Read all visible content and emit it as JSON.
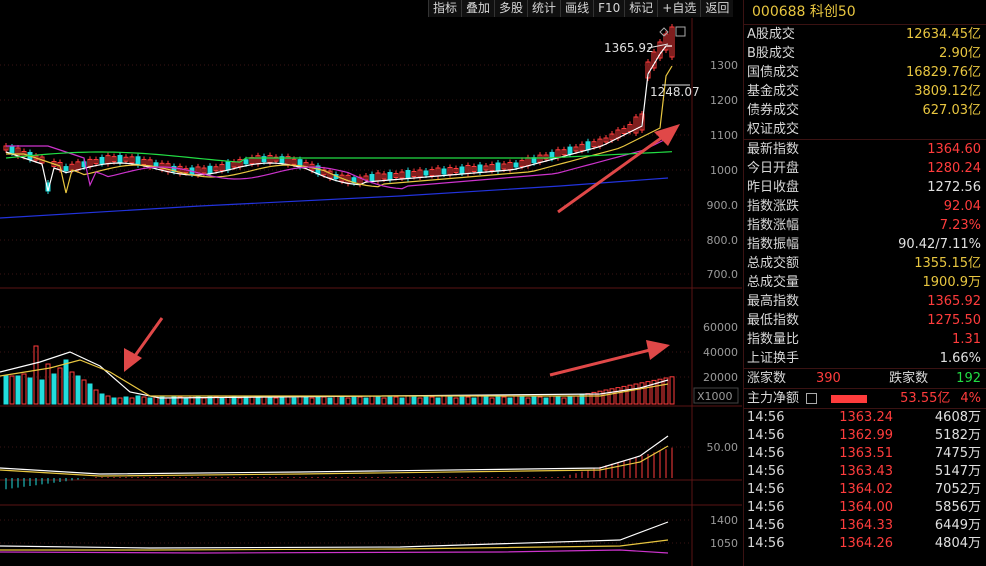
{
  "toolbar": {
    "items": [
      "指标",
      "叠加",
      "多股",
      "统计",
      "画线",
      "F10",
      "标记",
      "+自选",
      "返回"
    ]
  },
  "chart": {
    "price_axis": [
      "1300",
      "1200",
      "1100",
      "1000",
      "900.0",
      "800.0",
      "700.0"
    ],
    "high_label": "1365.92",
    "low_label": "1248.07",
    "volume_axis": [
      "60000",
      "40000",
      "20000"
    ],
    "volume_unit": "X1000",
    "indicator1_axis": [
      "50.00"
    ],
    "indicator2_axis": [
      "1400",
      "1050"
    ],
    "colors": {
      "up": "#ff3c3c",
      "down": "#22dddd",
      "ma5": "#ffffff",
      "ma10": "#e8c640",
      "ma20": "#cc33cc",
      "ma60": "#22dd44",
      "ma250": "#2233dd",
      "annotation": "#e04848"
    }
  },
  "panel": {
    "title": "000688 科创50",
    "market_stats": [
      {
        "label": "A股成交",
        "value": "12634.45亿"
      },
      {
        "label": "B股成交",
        "value": "2.90亿"
      },
      {
        "label": "国债成交",
        "value": "16829.76亿"
      },
      {
        "label": "基金成交",
        "value": "3809.12亿"
      },
      {
        "label": "债券成交",
        "value": "627.03亿"
      },
      {
        "label": "权证成交",
        "value": ""
      }
    ],
    "index_stats": [
      {
        "label": "最新指数",
        "value": "1364.60",
        "color": "red"
      },
      {
        "label": "今日开盘",
        "value": "1280.24",
        "color": "red"
      },
      {
        "label": "昨日收盘",
        "value": "1272.56",
        "color": "white"
      },
      {
        "label": "指数涨跌",
        "value": "92.04",
        "color": "red"
      },
      {
        "label": "指数涨幅",
        "value": "7.23%",
        "color": "red"
      },
      {
        "label": "指数振幅",
        "value": "90.42/7.11%",
        "color": "white"
      },
      {
        "label": "总成交额",
        "value": "1355.15亿",
        "color": "yellow"
      },
      {
        "label": "总成交量",
        "value": "1900.9万",
        "color": "yellow"
      },
      {
        "label": "最高指数",
        "value": "1365.92",
        "color": "red"
      },
      {
        "label": "最低指数",
        "value": "1275.50",
        "color": "red"
      },
      {
        "label": "指数量比",
        "value": "1.31",
        "color": "red"
      },
      {
        "label": "上证换手",
        "value": "1.66%",
        "color": "white"
      }
    ],
    "breadth": {
      "up_label": "涨家数",
      "up_value": "390",
      "down_label": "跌家数",
      "down_value": "192"
    },
    "main_flow": {
      "label": "主力净额",
      "value": "53.55亿",
      "pct": "4%"
    },
    "ticks": [
      {
        "time": "14:56",
        "price": "1363.24",
        "vol": "4608万"
      },
      {
        "time": "14:56",
        "price": "1362.99",
        "vol": "5182万"
      },
      {
        "time": "14:56",
        "price": "1363.51",
        "vol": "7475万"
      },
      {
        "time": "14:56",
        "price": "1363.43",
        "vol": "5147万"
      },
      {
        "time": "14:56",
        "price": "1364.02",
        "vol": "7052万"
      },
      {
        "time": "14:56",
        "price": "1364.00",
        "vol": "5856万"
      },
      {
        "time": "14:56",
        "price": "1364.33",
        "vol": "6449万"
      },
      {
        "time": "14:56",
        "price": "1364.26",
        "vol": "4804万"
      }
    ]
  }
}
